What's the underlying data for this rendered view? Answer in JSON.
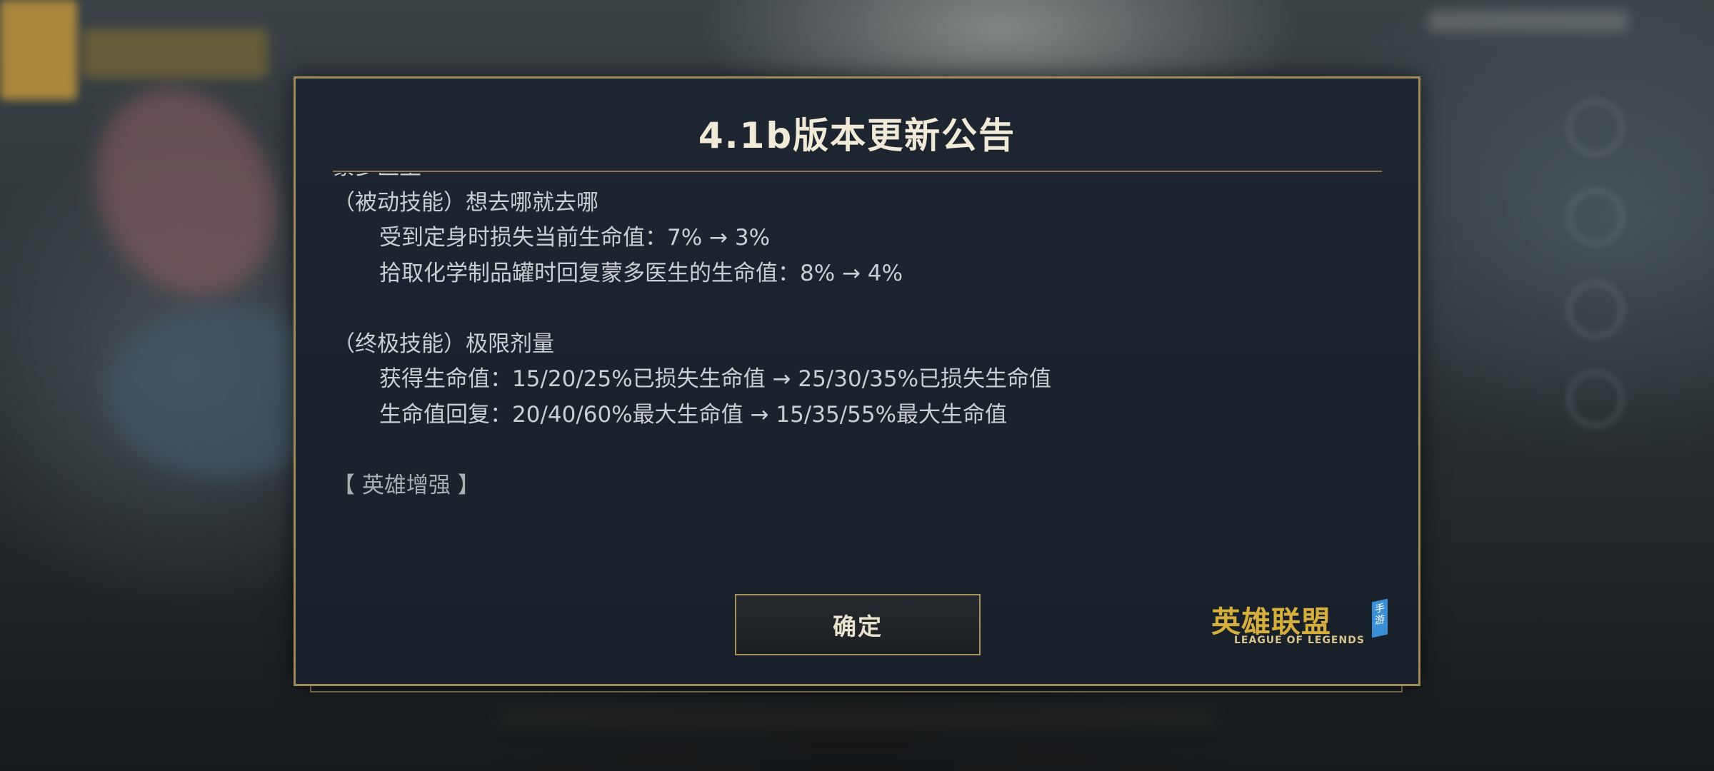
{
  "dialog": {
    "title": "4.1b版本更新公告",
    "lines": [
      {
        "text": "蒙多医生",
        "style": "plain"
      },
      {
        "text": "（被动技能）想去哪就去哪",
        "style": "plain"
      },
      {
        "text": "受到定身时损失当前生命值：7% → 3%",
        "style": "indent"
      },
      {
        "text": "拾取化学制品罐时回复蒙多医生的生命值：8% → 4%",
        "style": "indent"
      },
      {
        "text": "",
        "style": "gap"
      },
      {
        "text": "（终极技能）极限剂量",
        "style": "plain"
      },
      {
        "text": "获得生命值：15/20/25%已损失生命值 → 25/30/35%已损失生命值",
        "style": "indent"
      },
      {
        "text": "生命值回复：20/40/60%最大生命值 → 15/35/55%最大生命值",
        "style": "indent"
      },
      {
        "text": "",
        "style": "gap"
      },
      {
        "text": "【 英雄增强 】",
        "style": "heading"
      }
    ],
    "confirm_label": "确定"
  },
  "logo": {
    "chinese": "英雄联盟",
    "english": "LEAGUE OF LEGENDS",
    "badge": "手游"
  }
}
